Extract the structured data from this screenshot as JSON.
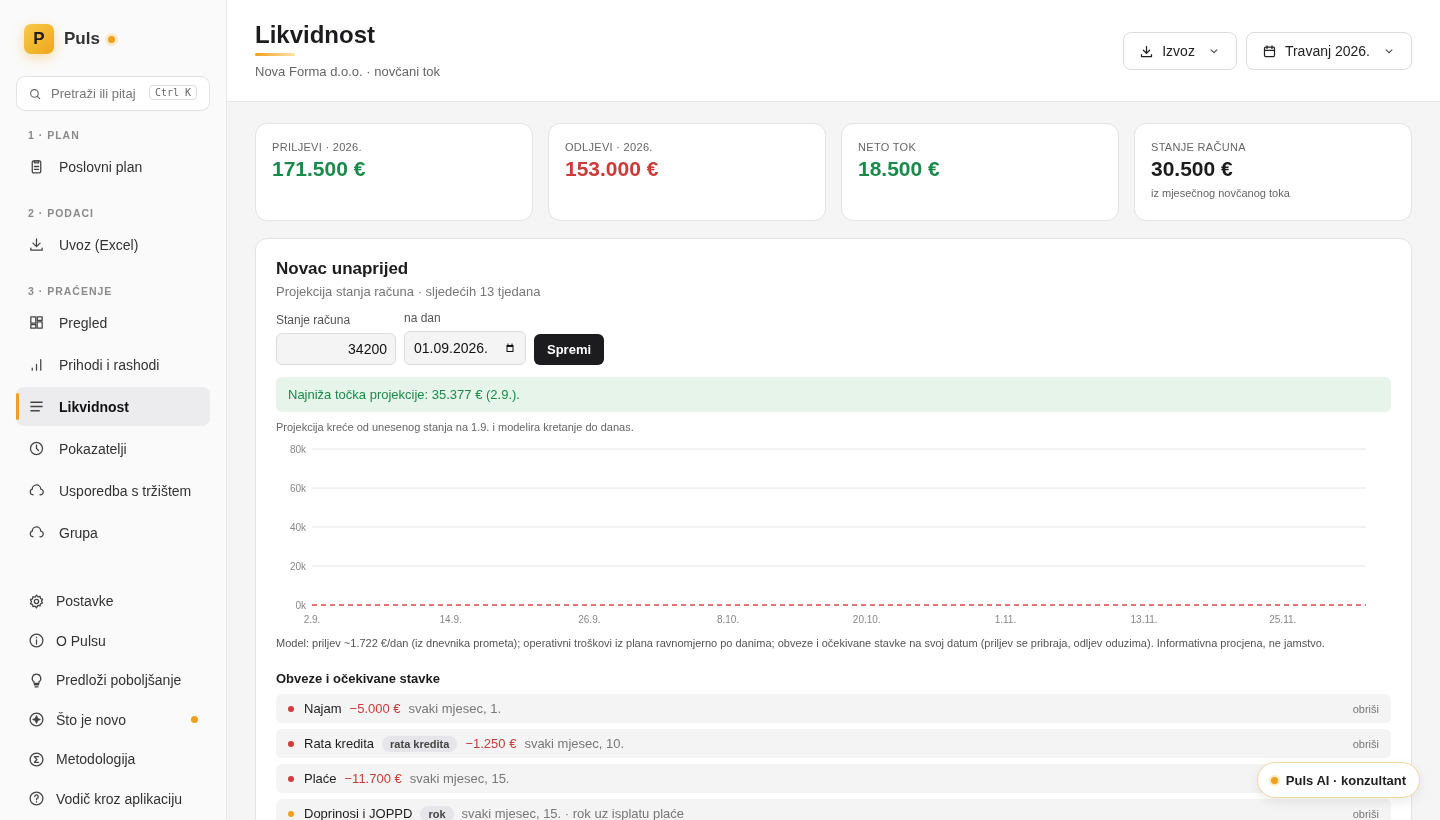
{
  "brand": {
    "logo_letter": "P",
    "name": "Puls",
    "status_dot": true
  },
  "search": {
    "placeholder": "Pretraži ili pitaj",
    "shortcut": "Ctrl K"
  },
  "sidebar": {
    "sections": [
      {
        "label": "1 · PLAN",
        "items": [
          {
            "label": "Poslovni plan",
            "selected": false
          }
        ]
      },
      {
        "label": "2 · PODACI",
        "items": [
          {
            "label": "Uvoz (Excel)",
            "selected": false
          }
        ]
      },
      {
        "label": "3 · PRAĆENJE",
        "items": [
          {
            "label": "Pregled",
            "selected": false
          },
          {
            "label": "Prihodi i rashodi",
            "selected": false
          },
          {
            "label": "Likvidnost",
            "selected": true
          },
          {
            "label": "Pokazatelji",
            "selected": false
          },
          {
            "label": "Usporedba s tržištem",
            "selected": false
          },
          {
            "label": "Grupa",
            "selected": false
          }
        ]
      }
    ],
    "footer_items": [
      {
        "label": "Postavke",
        "new": false
      },
      {
        "label": "O Pulsu",
        "new": false
      },
      {
        "label": "Predloži poboljšanje",
        "new": false
      },
      {
        "label": "Što je novo",
        "new": true
      },
      {
        "label": "Metodologija",
        "new": false
      },
      {
        "label": "Vodič kroz aplikaciju",
        "new": false
      }
    ]
  },
  "header": {
    "title": "Likvidnost",
    "subtitle": "Nova Forma d.o.o. · novčani tok",
    "buttons": [
      {
        "label": "Izvoz",
        "kind": "export"
      },
      {
        "label": "Travanj 2026.",
        "kind": "date"
      }
    ]
  },
  "kpis": [
    {
      "label": "PRILJEVI · 2026.",
      "value": "171.500 €",
      "color": "#1a8a4a"
    },
    {
      "label": "ODLJEVI · 2026.",
      "value": "153.000 €",
      "color": "#cc3a3a"
    },
    {
      "label": "NETO TOK",
      "value": "18.500 €",
      "color": "#1a8a4a"
    },
    {
      "label": "STANJE RAČUNA",
      "value": "30.500 €",
      "color": "#1c1c1e",
      "note": "iz mjesečnog novčanog toka"
    }
  ],
  "forecast": {
    "title": "Novac unaprijed",
    "subtitle": "Projekcija stanja računa · sljedećih 13 tjedana",
    "balance_field": {
      "label": "Stanje računa",
      "value": "34200"
    },
    "date_field": {
      "label": "na dan",
      "value": "01.09.2026."
    },
    "save_button": "Spremi",
    "alert": "Najniža točka projekcije: 35.377 € (2.9.).",
    "note": "Projekcija kreće od unesenog stanja na 1.9. i modelira kretanje do danas.",
    "chart_data": {
      "type": "line",
      "ylim": [
        0,
        80000
      ],
      "categories": [
        "2.9.",
        "14.9.",
        "26.9.",
        "8.10.",
        "20.10.",
        "1.11.",
        "13.11.",
        "25.11."
      ],
      "yticks": [
        {
          "value": 0,
          "label": "0k"
        },
        {
          "value": 20000,
          "label": "20k"
        },
        {
          "value": 40000,
          "label": "40k"
        },
        {
          "value": 60000,
          "label": "60k"
        },
        {
          "value": 80000,
          "label": "80k"
        }
      ],
      "grid": true,
      "ref_lines": [
        {
          "color": "#dc4a4a"
        }
      ]
    },
    "model_note": "Model: priljev ~1.722 €/dan (iz dnevnika prometa); operativni troškovi iz plana ravnomjerno po danima; obveze i očekivane stavke na svoj datum (priljev se pribraja, odljev oduzima). Informativna procjena, ne jamstvo.",
    "items_title": "Obveze i očekivane stavke",
    "items": [
      {
        "name": "Najam",
        "amount": "−5.000 €",
        "schedule": "svaki mjesec, 1.",
        "color": "#d13b3b",
        "delete": "obriši"
      },
      {
        "name": "Rata kredita",
        "tag": "rata kredita",
        "amount": "−1.250 €",
        "schedule": "svaki mjesec, 10.",
        "color": "#d13b3b",
        "delete": "obriši"
      },
      {
        "name": "Plaće",
        "amount": "−11.700 €",
        "schedule": "svaki mjesec, 15.",
        "color": "#d13b3b"
      },
      {
        "name": "Doprinosi i JOPPD",
        "tag": "rok",
        "schedule": "svaki mjesec, 15. · rok uz isplatu plaće",
        "color": "#f0a020",
        "delete": "obriši"
      }
    ]
  },
  "assistant": {
    "label": "Puls AI · konzultant"
  }
}
